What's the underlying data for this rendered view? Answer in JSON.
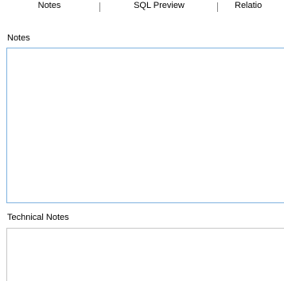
{
  "tabs": [
    {
      "label": "Notes",
      "active": true
    },
    {
      "label": "SQL Preview",
      "active": false
    },
    {
      "label": "Relatio",
      "active": false
    }
  ],
  "notes": {
    "label": "Notes",
    "value": ""
  },
  "technical_notes": {
    "label": "Technical Notes",
    "value": ""
  },
  "colors": {
    "focus_border": "#7fb2e0",
    "border": "#c7c7c7"
  }
}
